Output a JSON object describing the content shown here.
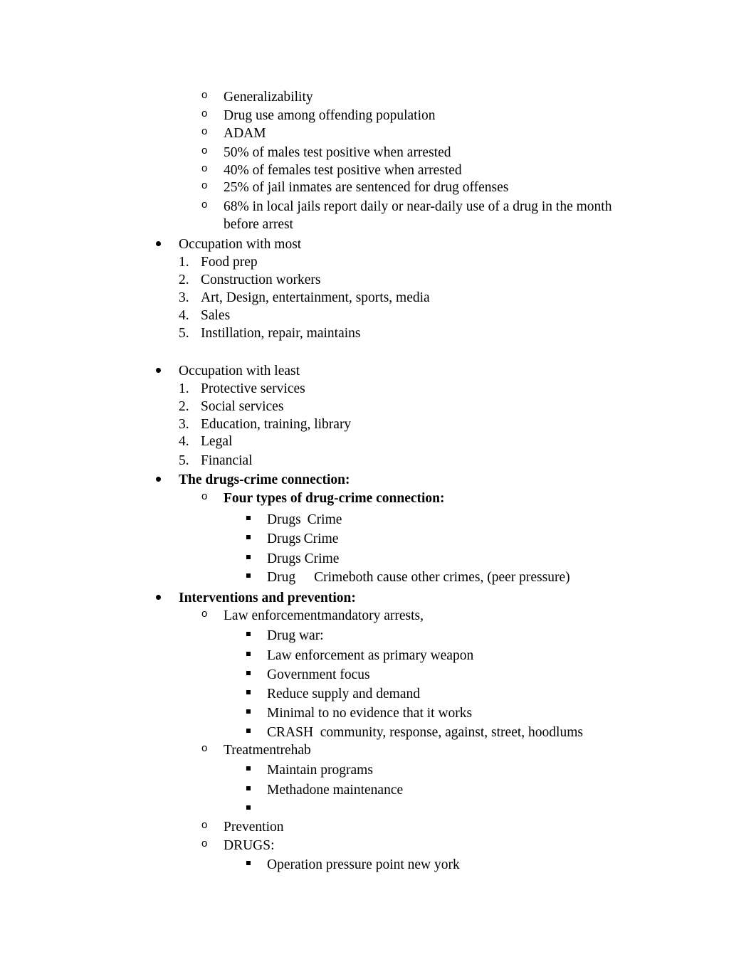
{
  "document": {
    "sections": {
      "intro_items": [
        "Generalizability",
        "Drug use among offending population",
        "ADAM",
        "50% of males test positive when arrested",
        "40% of females test positive when arrested",
        "25% of jail inmates are sentenced for drug offenses",
        "68% in local jails report daily or near-daily use of a drug in the month",
        "before arrest"
      ],
      "occupation_most": {
        "heading": "Occupation with most",
        "items": [
          {
            "num": "1.",
            "text": "Food prep"
          },
          {
            "num": "2.",
            "text": "Construction workers"
          },
          {
            "num": "3.",
            "text": "Art, Design, entertainment, sports, media"
          },
          {
            "num": "4.",
            "text": "Sales"
          },
          {
            "num": "5.",
            "text": "Instillation, repair, maintains"
          }
        ]
      },
      "occupation_least": {
        "heading": "Occupation with least",
        "items": [
          {
            "num": "1.",
            "text": "Protective services"
          },
          {
            "num": "2.",
            "text": "Social services"
          },
          {
            "num": "3.",
            "text": "Education, training, library"
          },
          {
            "num": "4.",
            "text": "Legal"
          },
          {
            "num": "5.",
            "text": "Financial"
          }
        ]
      },
      "drugs_crime": {
        "heading": "The drugs-crime connection:",
        "subheading": "Four types of drug-crime connection:",
        "types": [
          {
            "left": "Drugs",
            "right": "Crime",
            "note": ""
          },
          {
            "left": "Drugs",
            "right": "Crime",
            "note": ""
          },
          {
            "left": "Drugs",
            "right": "Crime",
            "note": ""
          },
          {
            "left": "Drug",
            "right": "Crime",
            "note": "both cause other crimes, (peer pressure)"
          }
        ]
      },
      "interventions": {
        "heading": "Interventions and prevention:",
        "law_enforcement": {
          "label": "Law enforcement",
          "suffix": "mandatory arrests,",
          "items": [
            "Drug war:",
            "Law enforcement as primary weapon",
            "Government focus",
            "Reduce supply and demand",
            "Minimal to no evidence that it works",
            "CRASH  community, response, against, street, hoodlums"
          ]
        },
        "treatment": {
          "label": "Treatment",
          "suffix": "rehab",
          "items": [
            "Maintain programs",
            "Methadone maintenance",
            ""
          ]
        },
        "prevention": {
          "label": "Prevention"
        },
        "drugs": {
          "label": "DRUGS:",
          "items": [
            "Operation pressure point new york"
          ]
        }
      }
    },
    "markers": {
      "circle": "o"
    }
  }
}
